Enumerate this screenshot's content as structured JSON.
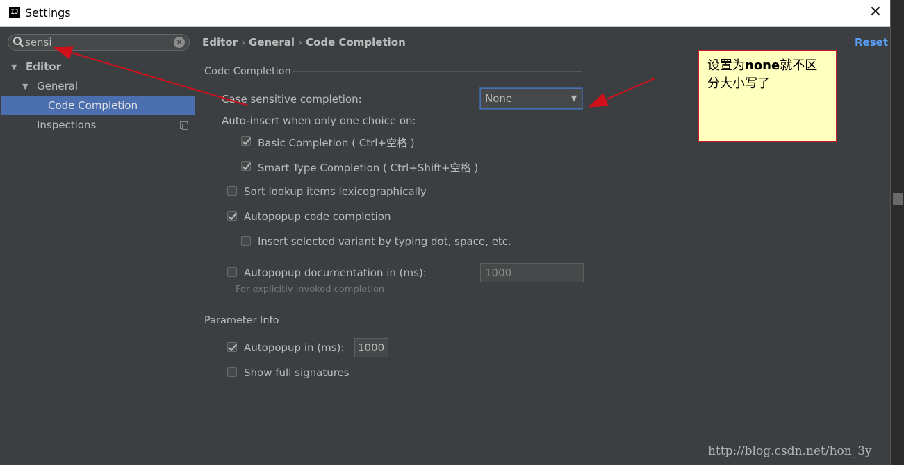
{
  "window": {
    "title": "Settings",
    "app_icon": "intellij-logo"
  },
  "sidebar": {
    "search_value": "sensi",
    "tree": {
      "editor": "Editor",
      "general": "General",
      "code_completion": "Code Completion",
      "inspections": "Inspections"
    }
  },
  "content": {
    "breadcrumb": [
      "Editor",
      "General",
      "Code Completion"
    ],
    "reset_label": "Reset",
    "code_completion": {
      "section_title": "Code Completion",
      "case_sensitive_label": "Case sensitive completion:",
      "case_sensitive_value": "None",
      "auto_insert_label": "Auto-insert when only one choice on:",
      "basic_completion": {
        "label": "Basic Completion ( Ctrl+空格 )",
        "checked": true
      },
      "smart_type_completion": {
        "label": "Smart Type Completion ( Ctrl+Shift+空格 )",
        "checked": true
      },
      "sort_lookup": {
        "label": "Sort lookup items lexicographically",
        "checked": false
      },
      "autopopup_code": {
        "label": "Autopopup code completion",
        "checked": true
      },
      "insert_variant": {
        "label": "Insert selected variant by typing dot, space, etc.",
        "checked": false
      },
      "autopopup_docs": {
        "label": "Autopopup documentation in (ms):",
        "checked": false,
        "value": "1000"
      },
      "hint": "For explicitly invoked completion"
    },
    "parameter_info": {
      "section_title": "Parameter Info",
      "autopopup": {
        "label": "Autopopup in (ms):",
        "checked": true,
        "value": "1000"
      },
      "show_full_signatures": {
        "label": "Show full signatures",
        "checked": false
      }
    }
  },
  "annotation": {
    "note_bold": "none",
    "note_before": "设置为",
    "note_after": "就不区分大小写了",
    "color": "#c8202a"
  },
  "watermark": "http://blog.csdn.net/hon_3y"
}
